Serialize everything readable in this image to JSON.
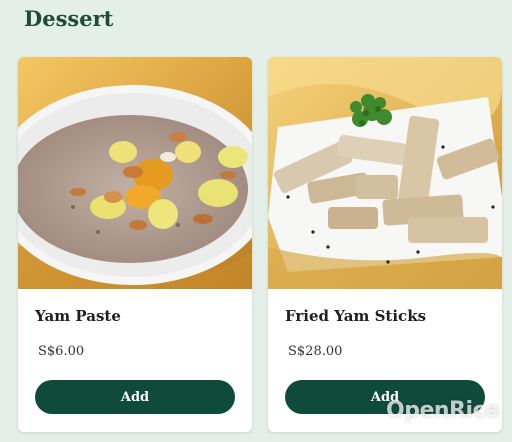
{
  "section": {
    "title": "Dessert"
  },
  "items": [
    {
      "name": "Yam Paste",
      "price": "S$6.00",
      "button_label": "Add",
      "image": "yam-paste-bowl"
    },
    {
      "name": "Fried Yam Sticks",
      "price": "S$28.00",
      "button_label": "Add",
      "image": "fried-yam-sticks-plate"
    }
  ],
  "watermark": {
    "text": "OpenRice"
  },
  "colors": {
    "background": "#e3efe8",
    "title": "#1e4a3a",
    "button": "#0f4a3a",
    "card": "#ffffff"
  }
}
